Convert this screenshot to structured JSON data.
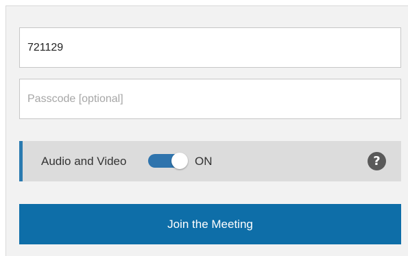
{
  "join_form": {
    "meeting_id": {
      "value": "721129"
    },
    "passcode": {
      "value": "",
      "placeholder": "Passcode [optional]"
    },
    "audio_video": {
      "label": "Audio and Video",
      "toggle_state": "ON",
      "enabled": true,
      "help_glyph": "?"
    },
    "join_button_label": "Join the Meeting"
  },
  "icons": {
    "help": "help-icon",
    "toggle": "toggle-switch"
  },
  "colors": {
    "panel_background": "#f2f2f2",
    "accent_blue": "#0e6ea8",
    "toggle_blue": "#2f74ad",
    "row_background": "#dcdcdc",
    "help_icon_gray": "#5a5a5a",
    "placeholder_gray": "#a6a6a6"
  }
}
